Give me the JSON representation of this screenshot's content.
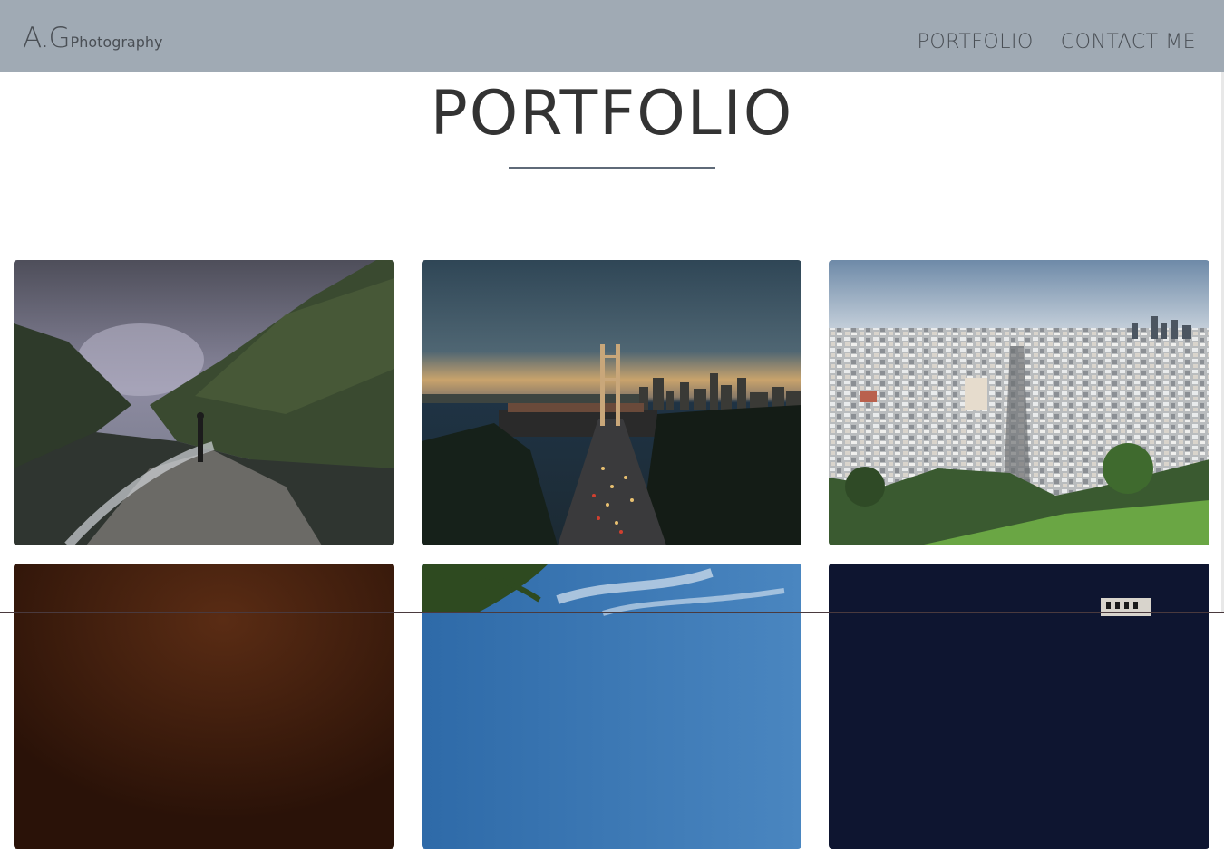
{
  "nav": {
    "brand_big": "A.G",
    "brand_small": "Photography",
    "links": [
      "PORTFOLIO",
      "CONTACT ME"
    ]
  },
  "main": {
    "title": "PORTFOLIO"
  },
  "gallery": {
    "items": [
      {
        "subject": "mountain-valley-storm"
      },
      {
        "subject": "bay-bridge-sunset"
      },
      {
        "subject": "city-panorama"
      },
      {
        "subject": "night-sky-dark-red"
      },
      {
        "subject": "palm-trees-blue-sky"
      },
      {
        "subject": "night-building"
      }
    ]
  },
  "colors": {
    "navbar_bg": "#a0aab4",
    "nav_text": "#4a4f55",
    "title_text": "#333333",
    "rule": "#5f6a78"
  }
}
